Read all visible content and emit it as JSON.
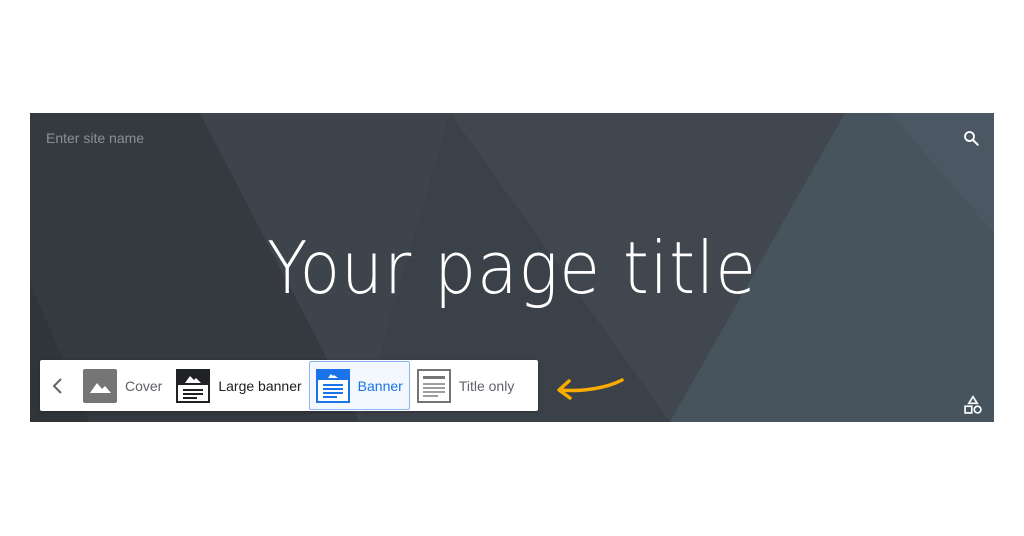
{
  "header": {
    "site_name_placeholder": "Enter site name",
    "page_title": "Your page title"
  },
  "layout_picker": {
    "options": [
      {
        "label": "Cover",
        "icon": "cover-layout-icon"
      },
      {
        "label": "Large banner",
        "icon": "large-banner-layout-icon"
      },
      {
        "label": "Banner",
        "icon": "banner-layout-icon",
        "selected": true
      },
      {
        "label": "Title only",
        "icon": "title-only-layout-icon"
      }
    ]
  },
  "icons": {
    "search": "search-icon",
    "back": "chevron-left-icon",
    "theme": "shapes-icon",
    "annotation": "curved-arrow-icon"
  },
  "colors": {
    "banner_bg": "#3a4046",
    "accent": "#1a73e8",
    "annotation_arrow": "#f9ab00"
  }
}
